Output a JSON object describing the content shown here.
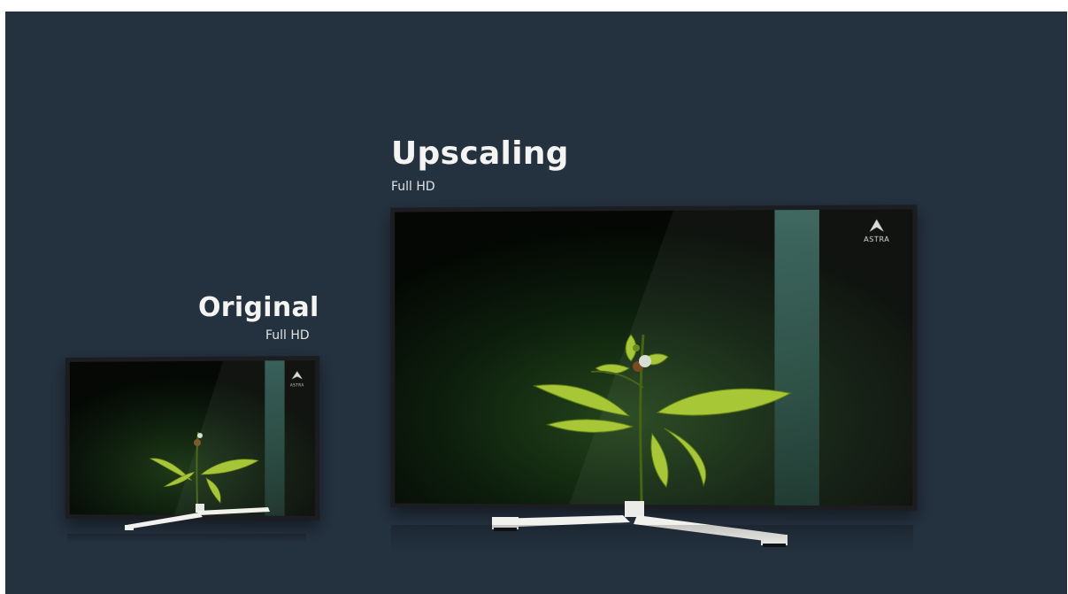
{
  "upscaling": {
    "title": "Upscaling",
    "resolution": "Full HD"
  },
  "original": {
    "title": "Original",
    "resolution": "Full HD"
  },
  "logo_text": "ASTRA",
  "colors": {
    "background": "#24313f",
    "text": "#f4f4f2",
    "leaf": "#9bbd2e",
    "bezel": "#1b1d20"
  }
}
